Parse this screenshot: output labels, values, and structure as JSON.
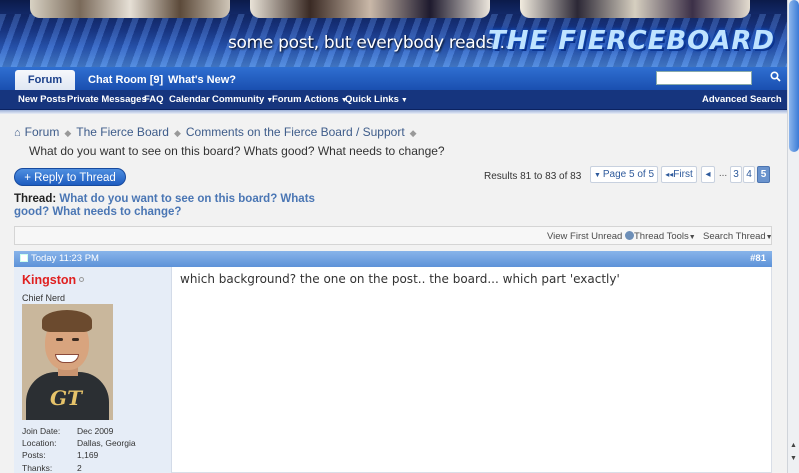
{
  "banner": {
    "tagline": "some post, but everybody reads...",
    "brand": "THE FIERCEBOARD"
  },
  "navtabs": {
    "forum": "Forum",
    "chat_room": "Chat Room [9]",
    "whats_new": "What's New?",
    "search_placeholder": "",
    "search_icon": "magnifier-icon"
  },
  "subnav": {
    "new_posts": "New Posts",
    "private_messages": "Private Messages",
    "faq": "FAQ",
    "calendar": "Calendar",
    "community": "Community",
    "forum_actions": "Forum Actions",
    "quick_links": "Quick Links",
    "advanced_search": "Advanced Search"
  },
  "breadcrumb": {
    "items": [
      "Forum",
      "The Fierce Board",
      "Comments on the Fierce Board / Support"
    ],
    "current": "What do you want to see on this board? Whats good? What needs to change?"
  },
  "reply_button": "+ Reply to Thread",
  "results": "Results 81 to 83 of 83",
  "pager": {
    "page_of": "Page 5 of 5",
    "first": "First",
    "prev": "◂",
    "ellipsis": "...",
    "pages": [
      "3",
      "4",
      "5"
    ],
    "current": "5"
  },
  "thread": {
    "label": "Thread:",
    "title": "What do you want to see on this board? Whats good? What needs to change?"
  },
  "tools": {
    "view_first_unread": "View First Unread",
    "thread_tools": "Thread Tools",
    "search_thread": "Search Thread"
  },
  "post": {
    "date": "Today 11:23 PM",
    "number": "#81",
    "username": "Kingston",
    "user_title": "Chief Nerd",
    "stats": [
      {
        "key": "Join Date:",
        "value": "Dec 2009"
      },
      {
        "key": "Location:",
        "value": "Dallas, Georgia"
      },
      {
        "key": "Posts:",
        "value": "1,169"
      },
      {
        "key": "Thanks:",
        "value": "2"
      }
    ],
    "message": "which background? the one on the post.. the board... which part 'exactly'"
  },
  "colors": {
    "nav_blue": "#1a4fb0",
    "subnav_blue": "#16357e",
    "username_red": "#e02020",
    "link_blue": "#3e5c8a",
    "post_head": "#5d92d8"
  }
}
